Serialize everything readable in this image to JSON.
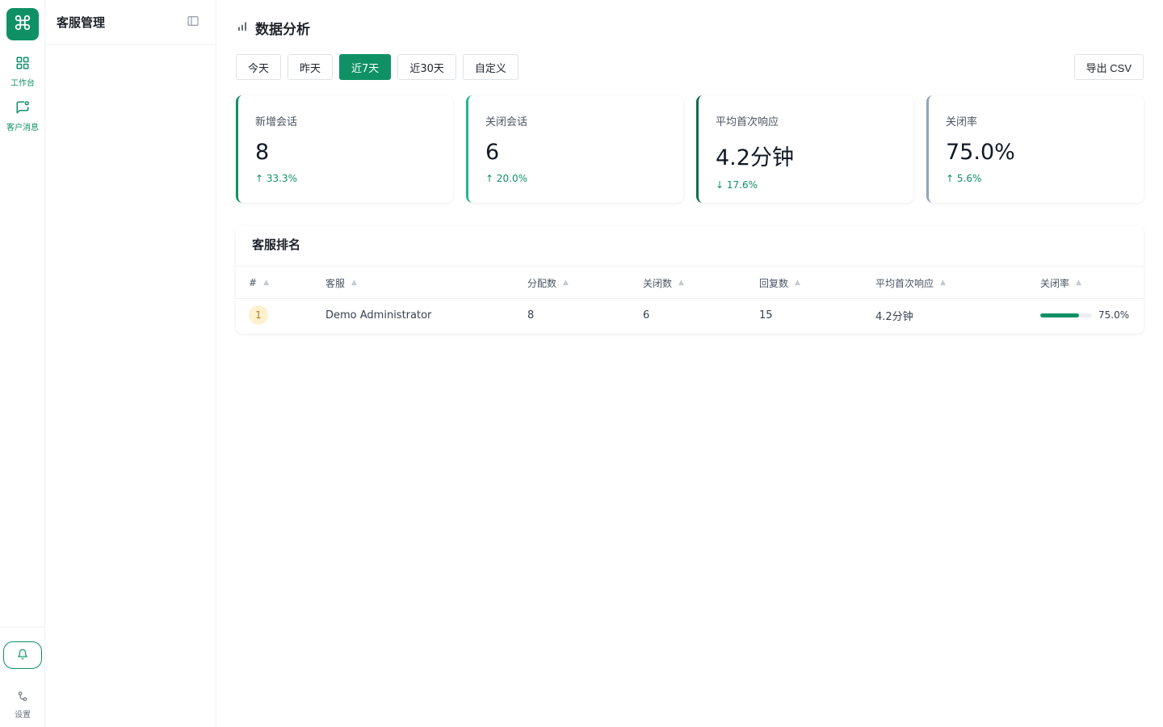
{
  "app": {
    "panel_title": "客服管理"
  },
  "rail": {
    "items": [
      {
        "label": "工作台",
        "icon": "grid-icon"
      },
      {
        "label": "客户消息",
        "icon": "chat-icon"
      }
    ],
    "settings_label": "设置"
  },
  "page": {
    "title": "数据分析"
  },
  "range": {
    "options": [
      "今天",
      "昨天",
      "近7天",
      "近30天",
      "自定义"
    ],
    "active": "近7天"
  },
  "export_label": "导出 CSV",
  "stats": [
    {
      "title": "新增会话",
      "value": "8",
      "delta": "↑ 33.3%",
      "accent": "#0f9165"
    },
    {
      "title": "关闭会话",
      "value": "6",
      "delta": "↑ 20.0%",
      "accent": "#26b58a"
    },
    {
      "title": "平均首次响应",
      "value": "4.2分钟",
      "delta": "↓ 17.6%",
      "accent": "#0b6e4f"
    },
    {
      "title": "关闭率",
      "value": "75.0%",
      "delta": "↑ 5.6%",
      "accent": "#94a3b8"
    }
  ],
  "ranking": {
    "title": "客服排名",
    "columns": [
      "#",
      "客服",
      "分配数",
      "关闭数",
      "回复数",
      "平均首次响应",
      "关闭率"
    ],
    "rows": [
      {
        "rank": "1",
        "agent": "Demo Administrator",
        "assigned": "8",
        "closed": "6",
        "replies": "15",
        "avg_response": "4.2分钟",
        "close_rate": "75.0%",
        "close_rate_fraction": 0.75
      }
    ]
  },
  "colors": {
    "accent": "#0f9165"
  }
}
